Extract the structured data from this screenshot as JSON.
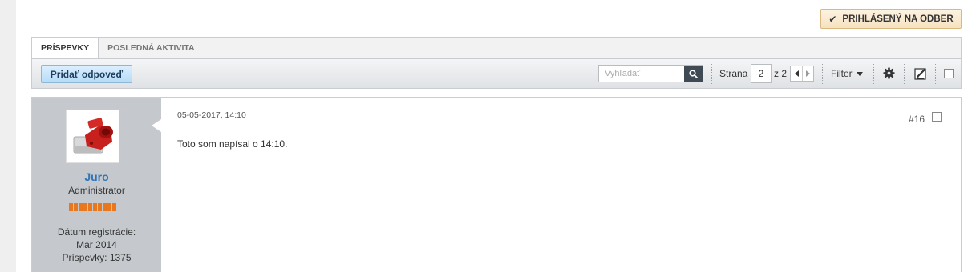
{
  "subscribe_button": {
    "label": "PRIHLÁSENÝ NA ODBER",
    "icon": "check-icon"
  },
  "tabs": [
    {
      "label": "PRÍSPEVKY",
      "active": true
    },
    {
      "label": "POSLEDNÁ AKTIVITA",
      "active": false
    }
  ],
  "toolbar": {
    "reply_label": "Pridať odpoveď",
    "search_placeholder": "Vyhľadať",
    "page_label": "Strana",
    "current_page": "2",
    "of_label": "z 2",
    "filter_label": "Filter",
    "icons": [
      "gear-icon",
      "edit-icon",
      "select-all-checkbox"
    ]
  },
  "post": {
    "date": "05-05-2017, 14:10",
    "number": "#16",
    "body": "Toto som napísal o 14:10.",
    "author": {
      "name": "Juro",
      "title": "Administrator",
      "reputation_level": 10,
      "join_label": "Dátum registrácie:",
      "join_date": "Mar 2014",
      "posts_label": "Príspevky:",
      "posts_count": "1375"
    }
  },
  "colors": {
    "accent_link": "#2d75b8",
    "subscribe_bg": "#f6e2c0",
    "reply_bg": "#b6dcf7",
    "reputation": "#e8771d",
    "userinfo_bg": "#c5c9cd"
  }
}
